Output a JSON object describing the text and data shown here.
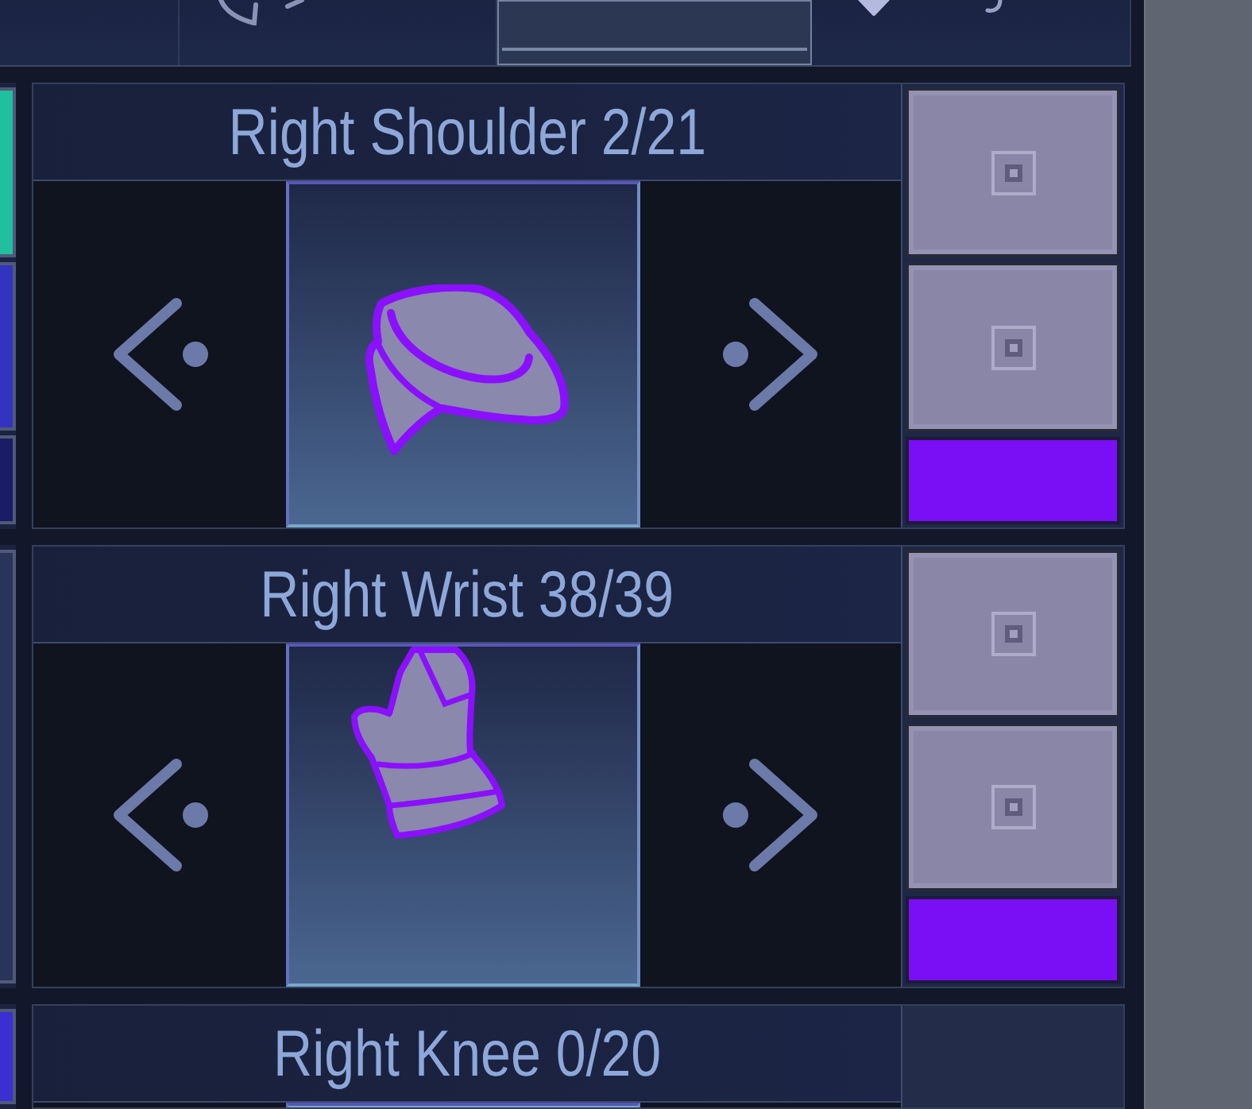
{
  "tabs": [
    {
      "selected": false
    },
    {
      "selected": false
    },
    {
      "selected": true
    },
    {
      "selected": false
    }
  ],
  "left_column": [
    {
      "swatches": [
        {
          "color": "#1fbf9f"
        },
        {
          "color": "#3333c2"
        },
        {
          "color": "#1a1c66"
        }
      ]
    },
    {
      "swatches": [
        {
          "color": "#2a3459"
        }
      ]
    },
    {
      "swatches": [
        {
          "color": "#3b2fd1"
        }
      ]
    }
  ],
  "slots": [
    {
      "title": "Right Shoulder 2/21",
      "kind": "shoulder",
      "swatches": [
        {
          "kind": "icon",
          "color": "#8986a8"
        },
        {
          "kind": "icon",
          "color": "#8986a8"
        },
        {
          "kind": "plain",
          "color": "#7a0ff5"
        }
      ]
    },
    {
      "title": "Right Wrist 38/39",
      "kind": "wrist",
      "swatches": [
        {
          "kind": "icon",
          "color": "#8986a8"
        },
        {
          "kind": "icon",
          "color": "#8986a8"
        },
        {
          "kind": "plain",
          "color": "#7a0ff5"
        }
      ]
    },
    {
      "title": "Right Knee 0/20"
    }
  ]
}
